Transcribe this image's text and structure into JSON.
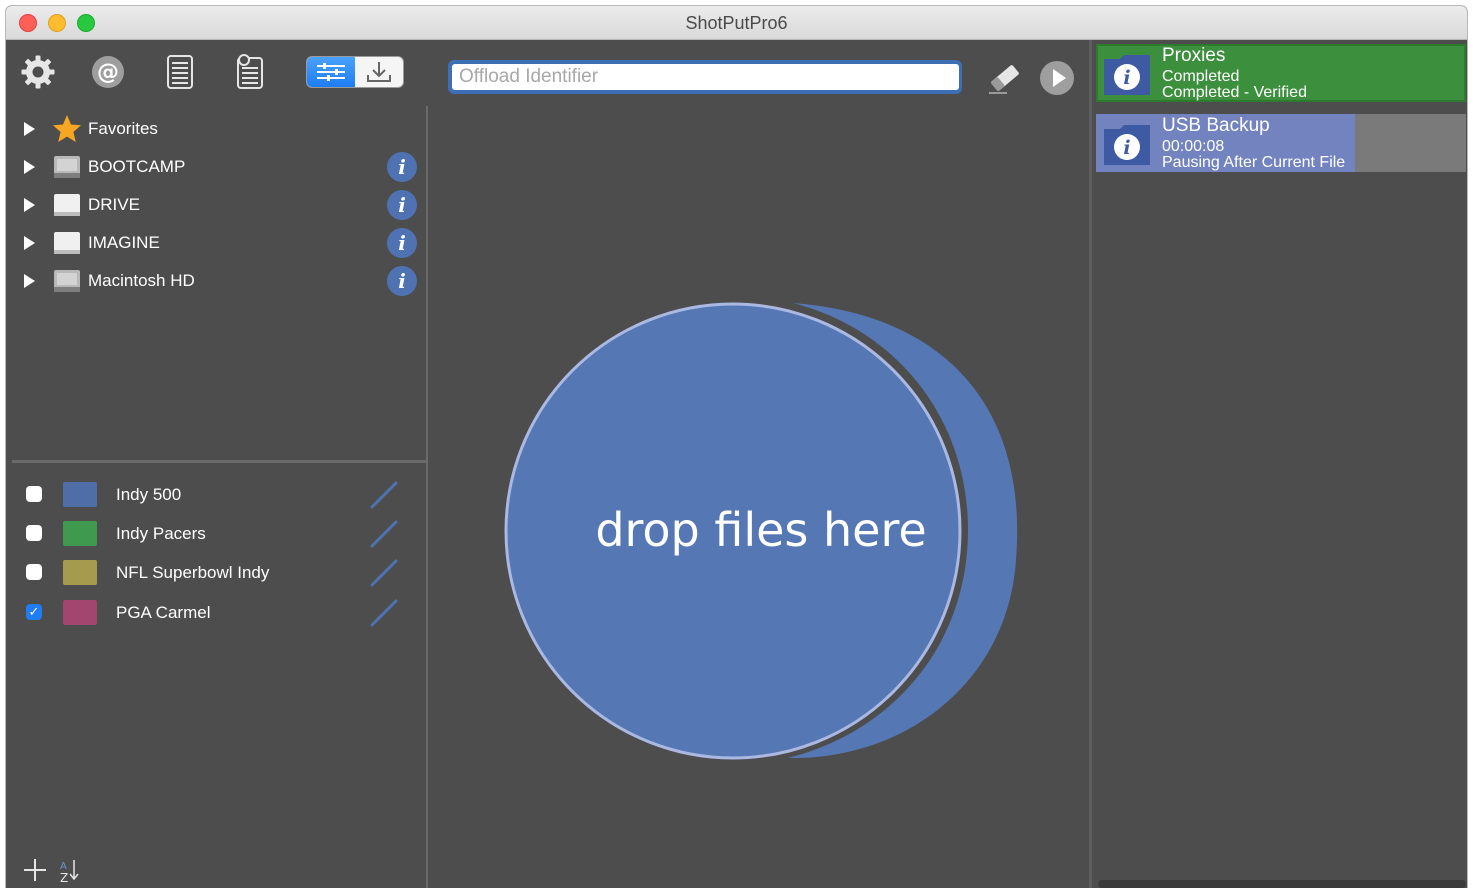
{
  "window": {
    "title": "ShotPutPro6"
  },
  "toolbar": {
    "icons": [
      "gear-icon",
      "at-icon",
      "report-icon",
      "report-settings-icon"
    ],
    "mode_toggle": [
      "sliders-icon",
      "download-icon"
    ],
    "offload_placeholder": "Offload Identifier",
    "clear_icon": "eraser-icon",
    "start_icon": "play-icon"
  },
  "sources": {
    "items": [
      {
        "label": "Favorites",
        "icon": "star-icon"
      },
      {
        "label": "BOOTCAMP",
        "icon": "internal-drive-icon"
      },
      {
        "label": "DRIVE",
        "icon": "external-drive-icon"
      },
      {
        "label": "IMAGINE",
        "icon": "external-drive-icon"
      },
      {
        "label": "Macintosh HD",
        "icon": "internal-drive-icon"
      }
    ],
    "info_glyph": "i"
  },
  "projects": {
    "items": [
      {
        "label": "Indy 500",
        "checked": false,
        "color": "#4f6ea8"
      },
      {
        "label": "Indy Pacers",
        "checked": false,
        "color": "#3f9a4f"
      },
      {
        "label": "NFL Superbowl Indy",
        "checked": false,
        "color": "#a59a4d"
      },
      {
        "label": "PGA Carmel",
        "checked": true,
        "color": "#a2456f"
      }
    ],
    "check_glyph": "✓",
    "add_icon": "plus-icon",
    "sort_icon": "sort-az-icon"
  },
  "dropzone": {
    "text": "drop files here",
    "color": "#5577b3"
  },
  "jobs": [
    {
      "title": "Proxies",
      "line1": "Completed",
      "line2": "Completed - Verified",
      "progress": 1.0,
      "bar_color": "#3c8f3c"
    },
    {
      "title": "USB Backup",
      "line1": "00:00:08",
      "line2": "Pausing After Current File",
      "progress": 0.7,
      "bar_color": "#7283bf"
    }
  ]
}
